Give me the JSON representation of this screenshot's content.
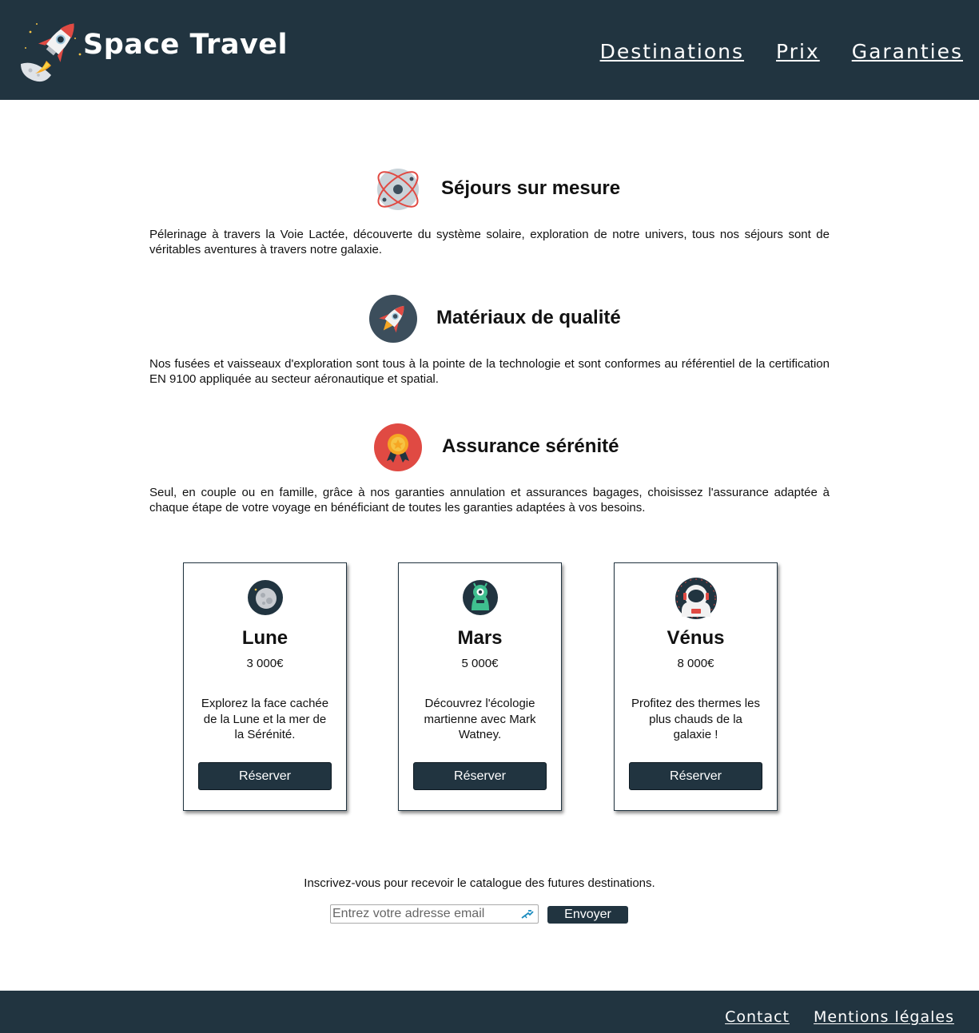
{
  "header": {
    "brand": "Space Travel",
    "nav": [
      "Destinations",
      "Prix",
      "Garanties"
    ]
  },
  "features": [
    {
      "icon": "atom-icon",
      "title": "Séjours sur mesure",
      "text": "Pélerinage à travers la Voie Lactée, découverte du système solaire, exploration de notre univers, tous nos séjours sont de véritables aventures à travers notre galaxie."
    },
    {
      "icon": "rocket-icon",
      "title": "Matériaux de qualité",
      "text": "Nos fusées et vaisseaux d'exploration sont tous à la pointe de la technologie et sont conformes au référentiel de la certification EN 9100 appliquée au secteur aéronautique et spatial."
    },
    {
      "icon": "medal-icon",
      "title": "Assurance sérénité",
      "text": "Seul, en couple ou en famille, grâce à nos garanties annulation et assurances bagages, choisissez l'assurance adaptée à chaque étape de votre voyage en bénéficiant de toutes les garanties adaptées à vos besoins."
    }
  ],
  "destinations": [
    {
      "icon": "moon-icon",
      "name": "Lune",
      "price": "3 000€",
      "description": "Explorez la face cachée de la Lune et la mer de la Sérénité.",
      "button": "Réserver"
    },
    {
      "icon": "alien-icon",
      "name": "Mars",
      "price": "5 000€",
      "description": "Découvrez l'écologie martienne avec Mark Watney.",
      "button": "Réserver"
    },
    {
      "icon": "astronaut-icon",
      "name": "Vénus",
      "price": "8 000€",
      "description": "Profitez des thermes les plus chauds de la galaxie !",
      "button": "Réserver"
    }
  ],
  "newsletter": {
    "text": "Inscrivez-vous pour recevoir le catalogue des futures destinations.",
    "placeholder": "Entrez votre adresse email",
    "button": "Envoyer"
  },
  "footer": {
    "links": [
      "Contact",
      "Mentions légales"
    ]
  },
  "colors": {
    "primary": "#213440",
    "accent_red": "#e04a43",
    "white": "#ffffff"
  }
}
